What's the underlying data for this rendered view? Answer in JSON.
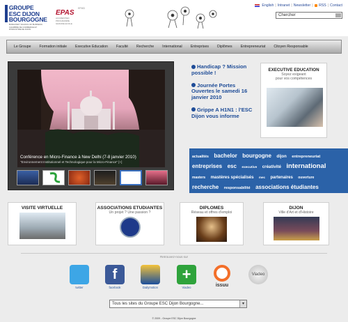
{
  "header": {
    "logo_line1": "GROUPE",
    "logo_line2": "ESC DIJON",
    "logo_line3": "BOURGOGNE",
    "logo_sub1": "BURGUNDY SCHOOL OF BUSINESS",
    "logo_sub2": "CHAMBRE DE COMMERCE ET D'INDUSTRIE DE DIJON",
    "efmd": "EFMD",
    "epas": "EPAS",
    "epas_sub1": "ACCREDITED",
    "epas_sub2": "PROGRAMME",
    "epas_sub3": "GRANDE ECOLE",
    "links": [
      "English",
      "Intranet",
      "Newsletter",
      "RSS",
      "Contact"
    ],
    "search_value": "Chercher"
  },
  "nav": {
    "items": [
      "Le Groupe",
      "Formation initiale",
      "Executive Education",
      "Faculté",
      "Recherche",
      "International",
      "Entreprises",
      "Diplômes",
      "Entrepreneuriat",
      "Citoyen Responsable"
    ]
  },
  "slideshow": {
    "caption": "Conférence en Micro-Finance à New Delhi (7-8 janvier 2010)",
    "caption_sub": "\"Environnement Institutionnel et Technologique pour la Micro-Finance\" [+]"
  },
  "news": [
    {
      "text": "Handicap ? Mission possible !"
    },
    {
      "text": "Journée Portes Ouvertes le samedi 16 janvier 2010"
    },
    {
      "text": "Grippe A H1N1 : l'ESC Dijon vous informe"
    }
  ],
  "exec": {
    "title": "EXECUTIVE EDUCATION",
    "sub1": "Soyez exigeant",
    "sub2": "pour vos compétences"
  },
  "tags": [
    {
      "t": "actualités",
      "s": 5.2
    },
    {
      "t": "bachelor",
      "s": 8
    },
    {
      "t": "bourgogne",
      "s": 8
    },
    {
      "t": "dijon",
      "s": 6
    },
    {
      "t": "entrepreneuriat",
      "s": 5.6
    },
    {
      "t": "entreprises",
      "s": 8
    },
    {
      "t": "esc",
      "s": 8
    },
    {
      "t": "executive",
      "s": 4.8
    },
    {
      "t": "créativité",
      "s": 6.2
    },
    {
      "t": "international",
      "s": 9.5
    },
    {
      "t": "masters",
      "s": 5
    },
    {
      "t": "mastères spécialisés",
      "s": 6.2
    },
    {
      "t": "mec",
      "s": 4.5
    },
    {
      "t": "partenaires",
      "s": 6
    },
    {
      "t": "ouverture",
      "s": 5
    },
    {
      "t": "recherche",
      "s": 8
    },
    {
      "t": "responsabilité",
      "s": 5.6
    },
    {
      "t": "associations étudiantes",
      "s": 8
    }
  ],
  "boxes": [
    {
      "title": "VISITE VIRTUELLE",
      "sub": ""
    },
    {
      "title": "ASSOCIATIONS ETUDIANTES",
      "sub": "Un projet ? Une passion ?"
    },
    {
      "title": "DIPLOMES",
      "sub": "Réseau et offres d'emploi"
    },
    {
      "title": "DIJON",
      "sub": "Ville d'Art et d'Histoire"
    }
  ],
  "retrouvez": "Retrouvez-nous sur",
  "social": [
    {
      "label": "twitter",
      "color": "#3da6e6"
    },
    {
      "label": "facebook",
      "color": "#3b5998"
    },
    {
      "label": "Dailymotion",
      "color": "#1b4f9c"
    },
    {
      "label": "Viadeo",
      "color": "#2fa33c"
    },
    {
      "label": "issuu",
      "color": "#f36f2a"
    },
    {
      "label": "",
      "color": "#bcbcbc"
    }
  ],
  "social_badges": {
    "viadeo_text": "+",
    "issuu_text": "issuu",
    "round_text": "Viadeo"
  },
  "sites_select": "Tous les sites du Groupe ESC Dijon Bourgogne...",
  "footer": "© 2009 - Groupe ESC Dijon Bourgogne"
}
